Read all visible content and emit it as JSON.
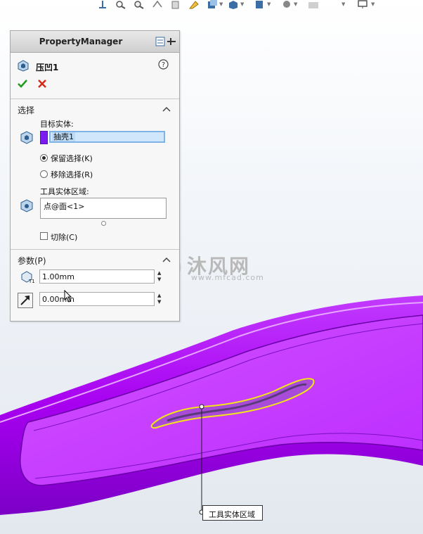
{
  "property_manager": {
    "title": "PropertyManager",
    "feature_name": "压凹1",
    "sections": {
      "selections": {
        "title": "选择",
        "target_body_label": "目标实体:",
        "target_body_item": "抽壳1",
        "keep_selection": "保留选择(K)",
        "remove_selection": "移除选择(R)",
        "tool_region_label": "工具实体区域:",
        "tool_region_item": "点@面<1>",
        "cut_label": "切除(C)"
      },
      "parameters": {
        "title": "参数(P)",
        "thickness_value": "1.00mm",
        "clearance_value": "0.00mm"
      }
    }
  },
  "viewport": {
    "callout_label": "工具实体区域",
    "watermark_main": "沐风网",
    "watermark_url": "www.mfcad.com"
  },
  "colors": {
    "body": "#b000f2",
    "accent": "#7a1cf0",
    "arrow": "#e3261f",
    "selection_box": "#cfe6fb"
  }
}
